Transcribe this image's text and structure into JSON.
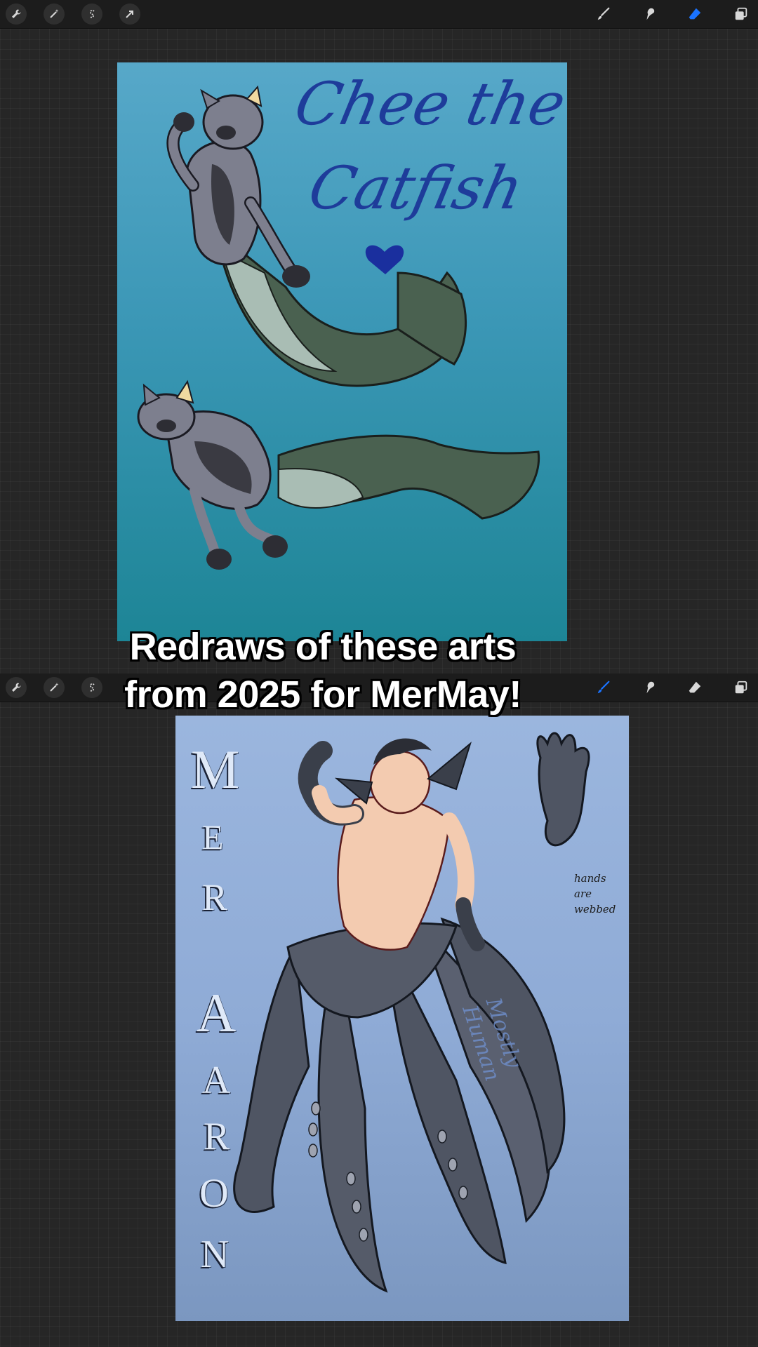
{
  "toolbar_top": {
    "left_tools": [
      "wrench-icon",
      "magic-wand-icon",
      "selection-s-icon",
      "arrow-icon"
    ],
    "right_tools": [
      "brush-icon",
      "smudge-icon",
      "eraser-icon",
      "layers-icon"
    ],
    "active_tool": "eraser-icon",
    "accent_color": "#1a73ff"
  },
  "toolbar_bottom": {
    "left_tools": [
      "wrench-icon",
      "magic-wand-icon",
      "selection-s-icon",
      "arrow-icon"
    ],
    "right_tools": [
      "brush-icon",
      "smudge-icon",
      "eraser-icon",
      "layers-icon"
    ],
    "active_tool": "brush-icon",
    "accent_color": "#1a73ff"
  },
  "artwork_1": {
    "title_line_1": "Chee the",
    "title_line_2": "Catfish",
    "heart_color": "#1a2f9e"
  },
  "artwork_2": {
    "vertical_title_1": [
      "M",
      "E",
      "R"
    ],
    "vertical_title_2": [
      "A",
      "A",
      "R",
      "O",
      "N"
    ],
    "note_line_1": "hands",
    "note_line_2": "are",
    "note_line_3": "webbed",
    "side_note": "Mostly Human"
  },
  "caption": {
    "line_1": "Redraws of these arts",
    "line_2": "from 2025 for MerMay!"
  }
}
